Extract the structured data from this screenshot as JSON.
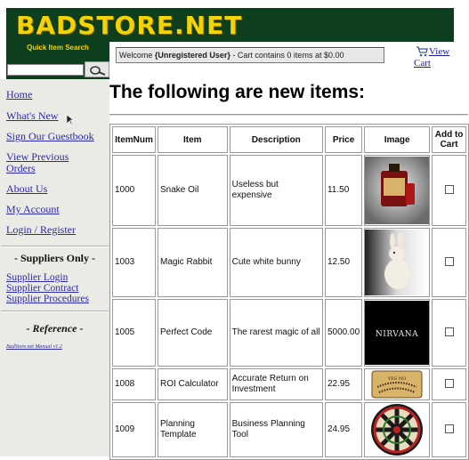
{
  "header": {
    "logo_text": "BADSTORE.NET",
    "quick_search_label": "Quick Item Search",
    "search_value": "",
    "welcome_prefix": "Welcome ",
    "welcome_user": "{Unregistered User}",
    "welcome_suffix": " - Cart contains 0 items at $0.00",
    "cart_link_line1": "View",
    "cart_link_line2": "Cart"
  },
  "sidebar": {
    "links": [
      {
        "label": "Home"
      },
      {
        "label": "What's New"
      },
      {
        "label": "Sign Our Guestbook"
      },
      {
        "label_line1": "View Previous",
        "label_line2": "Orders"
      },
      {
        "label": "About Us"
      },
      {
        "label": "My Account"
      },
      {
        "label": "Login / Register"
      }
    ],
    "suppliers_heading": "- Suppliers Only -",
    "supplier_links": [
      "Supplier Login",
      "Supplier Contract",
      "Supplier Procedures"
    ],
    "reference_heading": "- Reference -",
    "manual_link": "BadStore.net Manual v1.2"
  },
  "main": {
    "title": "The following are new items:",
    "columns": [
      "ItemNum",
      "Item",
      "Description",
      "Price",
      "Image",
      "Add to Cart"
    ],
    "rows": [
      {
        "num": "1000",
        "item": "Snake Oil",
        "desc": "Useless but expensive",
        "price": "11.50",
        "image": "snake-oil-bottle"
      },
      {
        "num": "1003",
        "item": "Magic Rabbit",
        "desc": "Cute white bunny",
        "price": "12.50",
        "image": "white-rabbit"
      },
      {
        "num": "1005",
        "item": "Perfect Code",
        "desc": "The rarest magic of all",
        "price": "5000.00",
        "image": "nirvana-logo",
        "image_text": "NIRVANA"
      },
      {
        "num": "1008",
        "item": "ROI Calculator",
        "desc": "Accurate Return on Investment",
        "price": "22.95",
        "image": "ouija-board",
        "image_text": "YES NO"
      },
      {
        "num": "1009",
        "item": "Planning Template",
        "desc": "Business Planning Tool",
        "price": "24.95",
        "image": "dartboard"
      }
    ]
  },
  "colors": {
    "header_green": "#0d3e1e",
    "logo_yellow": "#f4d300",
    "sidebar_bg": "#ebebe5",
    "link_blue": "#2a2aa8"
  }
}
